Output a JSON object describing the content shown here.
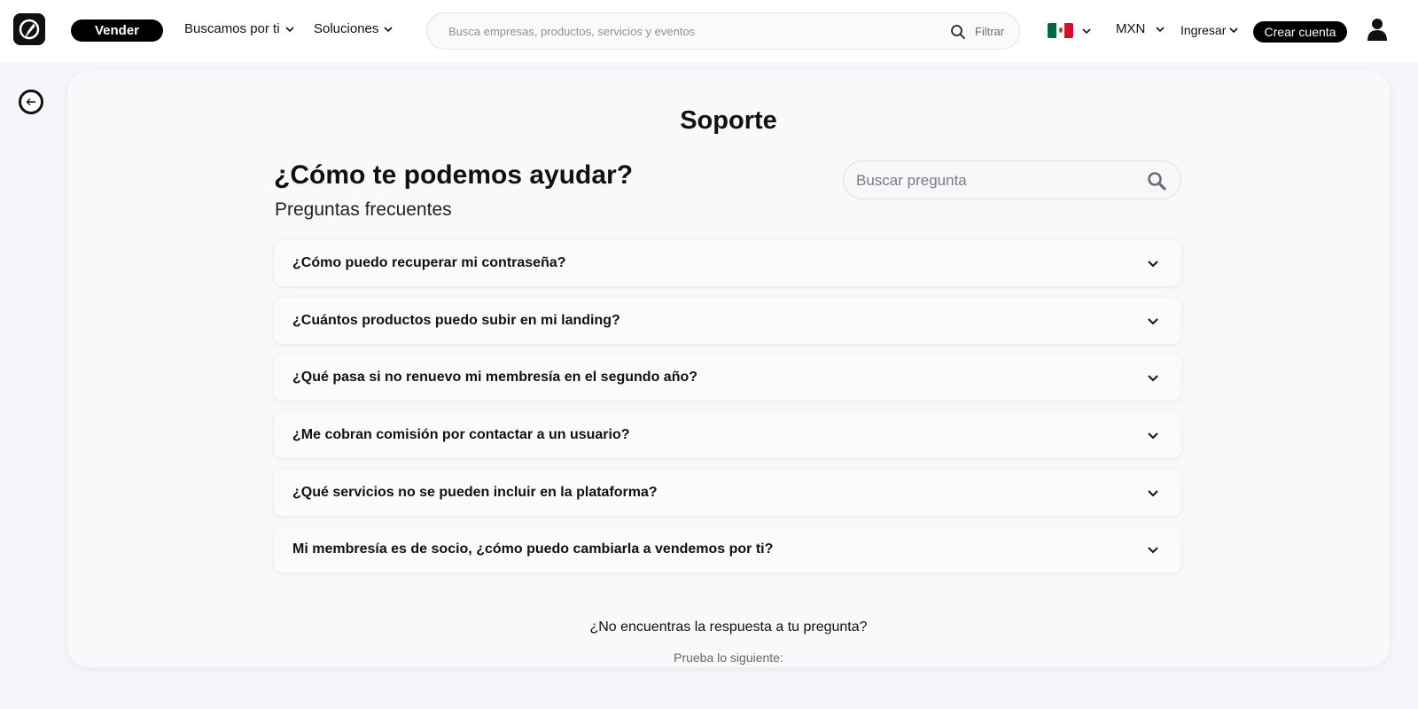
{
  "header": {
    "vender_label": "Vender",
    "nav": {
      "buscamos_label": "Buscamos por ti",
      "soluciones_label": "Soluciones"
    },
    "search": {
      "placeholder": "Busca empresas, productos, servicios y eventos",
      "filter_label": "Filtrar"
    },
    "currency": "MXN",
    "login_label": "Ingresar",
    "signup_label": "Crear cuenta",
    "icons": {
      "logo": "brand-logo-icon",
      "search": "search-icon",
      "country": "mexico-flag-icon",
      "user": "user-icon"
    }
  },
  "back_icon": "back-arrow-icon",
  "support": {
    "title": "Soporte",
    "headline": "¿Cómo te podemos ayudar?",
    "subheadline": "Preguntas frecuentes",
    "search_placeholder": "Buscar pregunta",
    "faqs": [
      {
        "question": "¿Cómo puedo recuperar mi contraseña?"
      },
      {
        "question": "¿Cuántos productos puedo subir en mi landing?"
      },
      {
        "question": "¿Qué pasa si no renuevo mi membresía en el segundo año?"
      },
      {
        "question": "¿Me cobran comisión por contactar a un usuario?"
      },
      {
        "question": "¿Qué servicios no se pueden incluir en la plataforma?"
      },
      {
        "question": "Mi membresía es de socio, ¿cómo puedo cambiarla a vendemos por ti?"
      }
    ],
    "no_answer": "¿No encuentras la respuesta a tu pregunta?",
    "try_label": "Prueba lo siguiente:"
  },
  "colors": {
    "primary": "#000000",
    "background": "#f5f6fa",
    "card": "#f9f9fc"
  }
}
